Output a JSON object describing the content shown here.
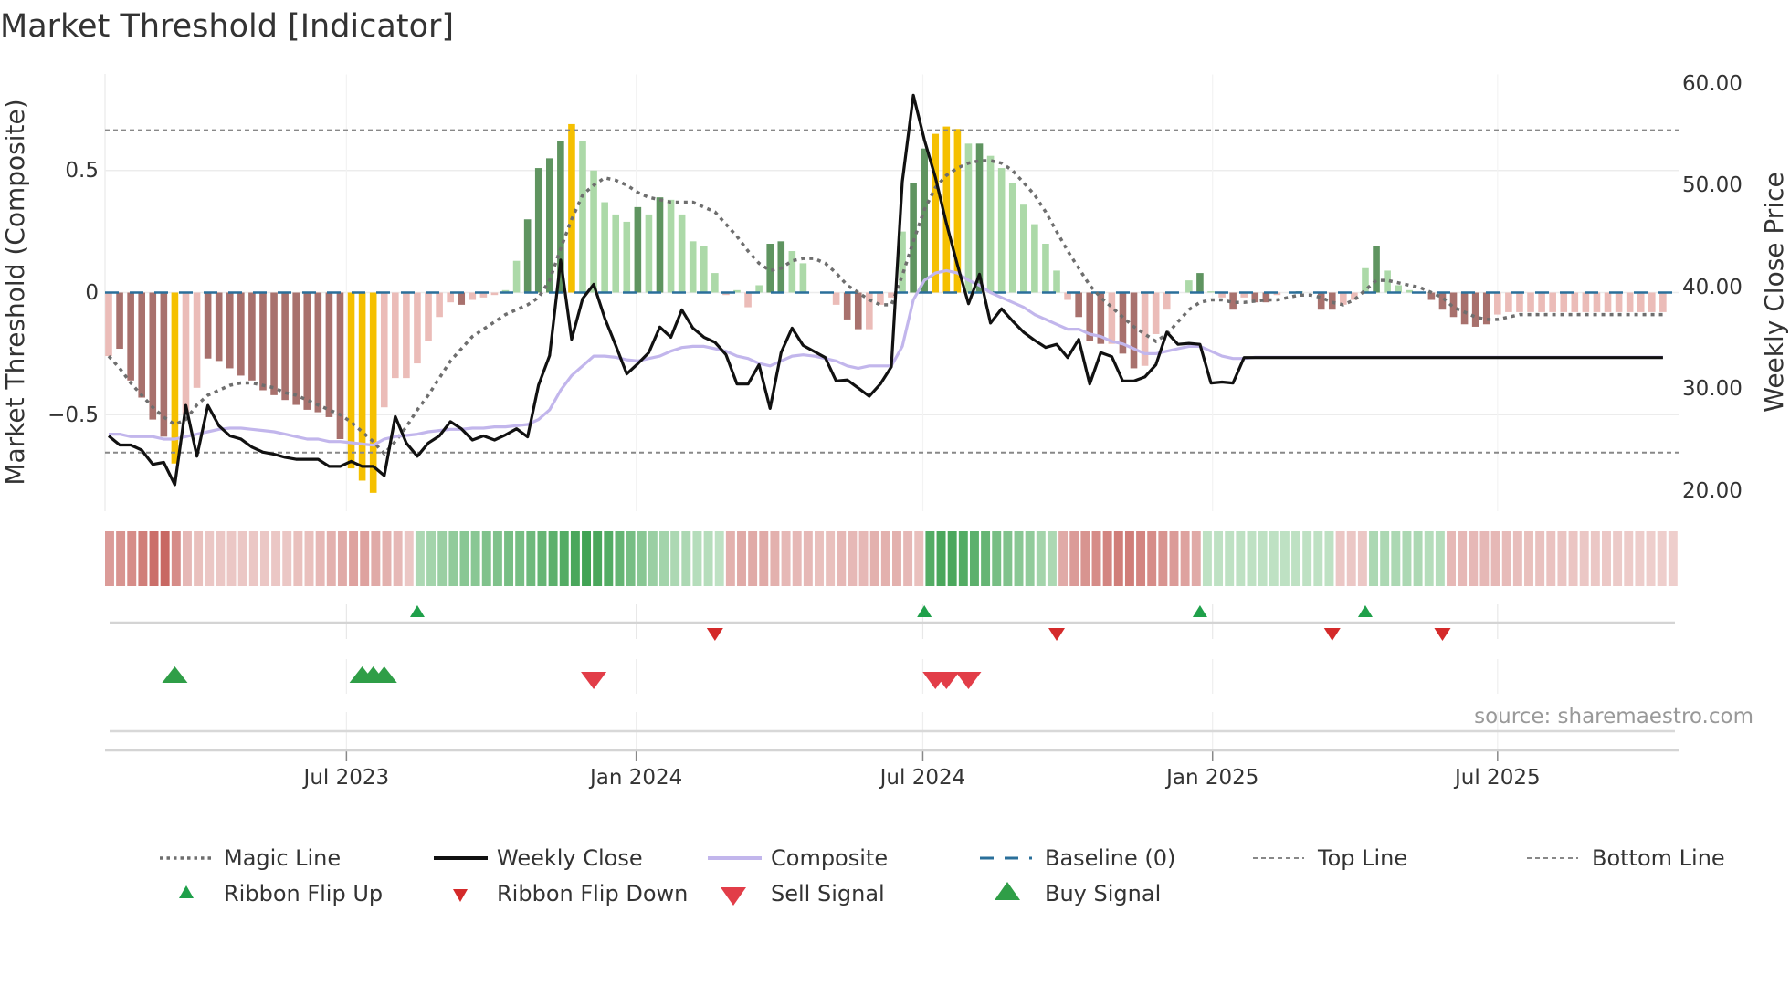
{
  "title": "Market Threshold [Indicator]",
  "source": "source: sharemaestro.com",
  "colors": {
    "bar_dark_red": "#a8716d",
    "bar_light_red": "#ebbcb8",
    "bar_yellow": "#f5c000",
    "bar_dark_green": "#5f9460",
    "bar_light_green": "#acd9a8",
    "close": "#111111",
    "composite": "#c2b6ec",
    "magic": "#6e6e6e",
    "baseline": "#2a6f9a",
    "threshold": "#888888",
    "flip_up": "#1fa04a",
    "flip_down": "#d42a2a",
    "sell": "#e23d48",
    "buy": "#2f9e47"
  },
  "chart_data": {
    "type": "bar+line",
    "title": "Market Threshold [Indicator]",
    "ylabel_left": "Market Threshold (Composite)",
    "ylabel_right": "Weekly Close Price",
    "ylim_left": [
      -0.9,
      0.89
    ],
    "ylim_right": [
      18.0,
      60.9
    ],
    "left_ticks": [
      "0.5",
      "0",
      "−0.5"
    ],
    "left_tick_values": [
      0.5,
      0,
      -0.5
    ],
    "right_ticks": [
      "60.00",
      "50.00",
      "40.00",
      "30.00",
      "20.00"
    ],
    "right_tick_values": [
      60,
      50,
      40,
      30,
      20
    ],
    "start_date": "2023-01-31",
    "x_unit": "week index from start_date",
    "x_ticks": [
      {
        "label": "Jul 2023",
        "date": "2023-07-01"
      },
      {
        "label": "Jan 2024",
        "date": "2024-01-01"
      },
      {
        "label": "Jul 2024",
        "date": "2024-07-01"
      },
      {
        "label": "Jan 2025",
        "date": "2025-01-01"
      },
      {
        "label": "Jul 2025",
        "date": "2025-07-01"
      }
    ],
    "top_line": 0.665,
    "bottom_line": -0.655,
    "baseline": 0,
    "bar_values": [
      -0.26,
      -0.23,
      -0.36,
      -0.43,
      -0.52,
      -0.59,
      -0.7,
      -0.5,
      -0.39,
      -0.27,
      -0.28,
      -0.31,
      -0.34,
      -0.36,
      -0.4,
      -0.42,
      -0.44,
      -0.46,
      -0.48,
      -0.49,
      -0.51,
      -0.6,
      -0.72,
      -0.77,
      -0.82,
      -0.47,
      -0.35,
      -0.35,
      -0.29,
      -0.2,
      -0.1,
      -0.04,
      -0.05,
      -0.03,
      -0.02,
      -0.01,
      0.01,
      0.13,
      0.3,
      0.51,
      0.55,
      0.62,
      0.69,
      0.62,
      0.5,
      0.37,
      0.32,
      0.29,
      0.35,
      0.32,
      0.39,
      0.38,
      0.32,
      0.21,
      0.19,
      0.08,
      -0.01,
      0.01,
      -0.06,
      0.03,
      0.2,
      0.21,
      0.17,
      0.12,
      0,
      0,
      -0.05,
      -0.11,
      -0.15,
      -0.15,
      -0.05,
      -0.02,
      0.25,
      0.45,
      0.59,
      0.65,
      0.68,
      0.67,
      0.61,
      0.61,
      0.56,
      0.51,
      0.45,
      0.36,
      0.28,
      0.2,
      0.09,
      -0.03,
      -0.1,
      -0.2,
      -0.21,
      -0.21,
      -0.25,
      -0.31,
      -0.3,
      -0.17,
      -0.07,
      0,
      0.05,
      0.08,
      0.005,
      -0.02,
      -0.07,
      -0.02,
      -0.04,
      -0.04,
      -0.01,
      0,
      0.005,
      0,
      -0.07,
      -0.07,
      -0.05,
      -0.03,
      0.1,
      0.19,
      0.09,
      0.03,
      0.01,
      0,
      -0.03,
      -0.07,
      -0.1,
      -0.13,
      -0.14,
      -0.13,
      -0.09,
      -0.08,
      -0.08,
      -0.08,
      -0.08,
      -0.08,
      -0.08,
      -0.08,
      -0.08,
      -0.08,
      -0.08,
      -0.08,
      -0.08,
      -0.08,
      -0.08,
      -0.08
    ],
    "bar_tones": [
      "L",
      "D",
      "D",
      "D",
      "D",
      "D",
      "Y",
      "L",
      "L",
      "D",
      "D",
      "D",
      "D",
      "D",
      "D",
      "D",
      "D",
      "D",
      "D",
      "D",
      "D",
      "D",
      "Y",
      "Y",
      "Y",
      "L",
      "L",
      "L",
      "L",
      "L",
      "L",
      "L",
      "D",
      "L",
      "L",
      "L",
      "G",
      "G",
      "DG",
      "DG",
      "DG",
      "DG",
      "Y",
      "G",
      "G",
      "G",
      "G",
      "G",
      "DG",
      "G",
      "DG",
      "G",
      "G",
      "G",
      "G",
      "G",
      "L",
      "G",
      "L",
      "G",
      "DG",
      "DG",
      "G",
      "G",
      "L",
      "L",
      "L",
      "D",
      "D",
      "L",
      "L",
      "L",
      "G",
      "DG",
      "DG",
      "Y",
      "Y",
      "Y",
      "G",
      "DG",
      "G",
      "G",
      "G",
      "G",
      "G",
      "G",
      "G",
      "L",
      "D",
      "D",
      "D",
      "L",
      "D",
      "D",
      "L",
      "L",
      "L",
      "L",
      "G",
      "DG",
      "G",
      "L",
      "D",
      "L",
      "D",
      "D",
      "L",
      "L",
      "DG",
      "L",
      "D",
      "D",
      "L",
      "L",
      "G",
      "DG",
      "G",
      "G",
      "G",
      "L",
      "D",
      "D",
      "D",
      "D",
      "D",
      "D",
      "L",
      "L",
      "L",
      "L",
      "L",
      "L",
      "L",
      "L",
      "L",
      "L",
      "L",
      "L",
      "L",
      "L",
      "L",
      "L"
    ],
    "series": [
      {
        "name": "Weekly Close",
        "axis": "right",
        "values": [
          25.3,
          24.4,
          24.4,
          23.9,
          22.5,
          22.7,
          20.5,
          28.3,
          23.3,
          28.3,
          26.3,
          25.3,
          25.0,
          24.2,
          23.7,
          23.5,
          23.2,
          23.0,
          23.0,
          23.0,
          22.3,
          22.3,
          22.8,
          22.3,
          22.3,
          21.4,
          27.2,
          24.6,
          23.3,
          24.6,
          25.3,
          26.7,
          26.0,
          24.9,
          25.3,
          24.9,
          25.4,
          26.0,
          25.2,
          30.3,
          33.2,
          42.6,
          34.8,
          38.8,
          40.2,
          36.9,
          34.2,
          31.4,
          32.4,
          33.5,
          36.0,
          35.0,
          37.7,
          35.9,
          35.0,
          34.5,
          33.3,
          30.4,
          30.4,
          32.3,
          28.0,
          33.5,
          35.9,
          34.2,
          33.6,
          33.0,
          30.7,
          30.8,
          30.0,
          29.2,
          30.4,
          32.1,
          50.3,
          58.8,
          54.4,
          50.7,
          46.2,
          42.1,
          38.3,
          41.2,
          36.4,
          37.8,
          36.6,
          35.5,
          34.7,
          34.0,
          34.3,
          33.0,
          34.8,
          30.4,
          33.5,
          33.1,
          30.7,
          30.7,
          31.1,
          32.3,
          35.5,
          34.3,
          34.4,
          34.3,
          30.5,
          30.6,
          30.5,
          33.0,
          33.0,
          33.0,
          33.0,
          33.0,
          33.0,
          33.0,
          33.0,
          33.0,
          33.0,
          33.0,
          33.0,
          33.0,
          33.0,
          33.0,
          33.0,
          33.0,
          33.0,
          33.0,
          33.0,
          33.0,
          33.0,
          33.0,
          33.0,
          33.0,
          33.0,
          33.0,
          33.0,
          33.0,
          33.0,
          33.0,
          33.0,
          33.0,
          33.0,
          33.0,
          33.0,
          33.0,
          33.0,
          33.0
        ]
      },
      {
        "name": "Composite",
        "axis": "left",
        "values": [
          -0.58,
          -0.58,
          -0.59,
          -0.59,
          -0.59,
          -0.6,
          -0.6,
          -0.59,
          -0.58,
          -0.57,
          -0.56,
          -0.555,
          -0.555,
          -0.56,
          -0.565,
          -0.57,
          -0.58,
          -0.59,
          -0.6,
          -0.6,
          -0.61,
          -0.61,
          -0.615,
          -0.62,
          -0.625,
          -0.6,
          -0.59,
          -0.585,
          -0.58,
          -0.57,
          -0.565,
          -0.56,
          -0.56,
          -0.555,
          -0.555,
          -0.55,
          -0.55,
          -0.545,
          -0.54,
          -0.52,
          -0.48,
          -0.4,
          -0.34,
          -0.3,
          -0.26,
          -0.26,
          -0.265,
          -0.275,
          -0.28,
          -0.27,
          -0.26,
          -0.24,
          -0.225,
          -0.22,
          -0.22,
          -0.23,
          -0.24,
          -0.26,
          -0.27,
          -0.29,
          -0.3,
          -0.28,
          -0.26,
          -0.255,
          -0.26,
          -0.27,
          -0.28,
          -0.3,
          -0.31,
          -0.3,
          -0.3,
          -0.3,
          -0.22,
          -0.03,
          0.05,
          0.08,
          0.09,
          0.08,
          0.05,
          0.03,
          0.0,
          -0.02,
          -0.04,
          -0.06,
          -0.09,
          -0.11,
          -0.13,
          -0.15,
          -0.15,
          -0.17,
          -0.18,
          -0.2,
          -0.21,
          -0.23,
          -0.25,
          -0.25,
          -0.24,
          -0.23,
          -0.22,
          -0.22,
          -0.24,
          -0.26,
          -0.27,
          -0.27,
          -0.265,
          -0.265,
          -0.265,
          -0.265,
          -0.265,
          -0.265,
          -0.265,
          -0.265,
          -0.265,
          -0.265,
          -0.265,
          -0.265,
          -0.265,
          -0.265,
          -0.265,
          -0.265,
          -0.265,
          -0.265,
          -0.265,
          -0.265,
          -0.265,
          -0.265,
          -0.265,
          -0.265,
          -0.265,
          -0.265,
          -0.265,
          -0.265,
          -0.265,
          -0.265,
          -0.265,
          -0.265,
          -0.265,
          -0.265,
          -0.265,
          -0.265,
          -0.265,
          -0.265
        ]
      },
      {
        "name": "Magic Line",
        "axis": "left",
        "values": [
          -0.26,
          -0.31,
          -0.37,
          -0.42,
          -0.47,
          -0.51,
          -0.54,
          -0.52,
          -0.46,
          -0.42,
          -0.4,
          -0.38,
          -0.37,
          -0.37,
          -0.38,
          -0.39,
          -0.41,
          -0.42,
          -0.44,
          -0.46,
          -0.48,
          -0.5,
          -0.53,
          -0.57,
          -0.61,
          -0.66,
          -0.61,
          -0.55,
          -0.48,
          -0.42,
          -0.35,
          -0.28,
          -0.23,
          -0.18,
          -0.15,
          -0.12,
          -0.09,
          -0.07,
          -0.05,
          -0.02,
          0.05,
          0.18,
          0.3,
          0.4,
          0.44,
          0.47,
          0.46,
          0.44,
          0.41,
          0.39,
          0.38,
          0.37,
          0.37,
          0.37,
          0.35,
          0.33,
          0.28,
          0.23,
          0.17,
          0.12,
          0.09,
          0.1,
          0.13,
          0.14,
          0.14,
          0.12,
          0.08,
          0.03,
          0.0,
          -0.03,
          -0.05,
          -0.05,
          0.07,
          0.21,
          0.34,
          0.43,
          0.48,
          0.51,
          0.53,
          0.54,
          0.54,
          0.53,
          0.5,
          0.45,
          0.4,
          0.33,
          0.25,
          0.17,
          0.1,
          0.03,
          -0.02,
          -0.06,
          -0.1,
          -0.14,
          -0.17,
          -0.2,
          -0.17,
          -0.12,
          -0.07,
          -0.04,
          -0.03,
          -0.03,
          -0.04,
          -0.04,
          -0.035,
          -0.03,
          -0.03,
          -0.02,
          -0.01,
          -0.01,
          -0.02,
          -0.04,
          -0.05,
          -0.03,
          0.01,
          0.05,
          0.05,
          0.04,
          0.03,
          0.02,
          0.0,
          -0.02,
          -0.06,
          -0.08,
          -0.1,
          -0.11,
          -0.11,
          -0.1,
          -0.09,
          -0.09,
          -0.09,
          -0.09,
          -0.09,
          -0.09,
          -0.09,
          -0.09,
          -0.09,
          -0.09,
          -0.09,
          -0.09,
          -0.09,
          -0.09
        ]
      }
    ],
    "ribbon": [
      -0.5,
      -0.55,
      -0.6,
      -0.7,
      -0.8,
      -0.85,
      -0.6,
      -0.3,
      -0.25,
      -0.2,
      -0.2,
      -0.2,
      -0.2,
      -0.2,
      -0.2,
      -0.2,
      -0.2,
      -0.25,
      -0.25,
      -0.3,
      -0.35,
      -0.4,
      -0.45,
      -0.45,
      -0.4,
      -0.35,
      -0.3,
      -0.2,
      0.3,
      0.35,
      0.4,
      0.45,
      0.5,
      0.5,
      0.55,
      0.55,
      0.6,
      0.6,
      0.65,
      0.7,
      0.75,
      0.8,
      0.85,
      0.9,
      0.85,
      0.8,
      0.7,
      0.6,
      0.5,
      0.4,
      0.35,
      0.3,
      0.3,
      0.25,
      0.25,
      0.2,
      -0.35,
      -0.4,
      -0.4,
      -0.4,
      -0.35,
      -0.3,
      -0.3,
      -0.3,
      -0.25,
      -0.25,
      -0.3,
      -0.3,
      -0.3,
      -0.35,
      -0.35,
      -0.35,
      -0.3,
      -0.25,
      0.8,
      0.85,
      0.85,
      0.8,
      0.75,
      0.7,
      0.6,
      0.55,
      0.5,
      0.45,
      0.35,
      0.3,
      -0.4,
      -0.5,
      -0.55,
      -0.6,
      -0.65,
      -0.7,
      -0.7,
      -0.65,
      -0.6,
      -0.55,
      -0.5,
      -0.45,
      -0.4,
      0.2,
      0.2,
      0.2,
      0.2,
      0.2,
      0.2,
      0.2,
      0.2,
      0.2,
      0.2,
      0.2,
      0.2,
      -0.2,
      -0.2,
      -0.2,
      0.3,
      0.3,
      0.3,
      0.3,
      0.3,
      0.25,
      0.25,
      -0.3,
      -0.3,
      -0.3,
      -0.3,
      -0.3,
      -0.28,
      -0.26,
      -0.25,
      -0.24,
      -0.23,
      -0.22,
      -0.21,
      -0.2,
      -0.2,
      -0.19,
      -0.18,
      -0.17,
      -0.16,
      -0.15,
      -0.15,
      -0.15
    ],
    "ribbon_flip_up_weeks": [
      28,
      74,
      99,
      114
    ],
    "ribbon_flip_down_weeks": [
      55,
      86,
      111,
      121
    ],
    "buy_signal_weeks": [
      6,
      23,
      24,
      25
    ],
    "sell_signal_weeks": [
      44,
      75,
      76,
      78
    ],
    "legend": {
      "placement": "bottom",
      "items": [
        "Magic Line",
        "Weekly Close",
        "Composite",
        "Baseline (0)",
        "Top Line",
        "Bottom Line",
        "Ribbon Flip Up",
        "Ribbon Flip Down",
        "Sell Signal",
        "Buy Signal"
      ]
    }
  }
}
